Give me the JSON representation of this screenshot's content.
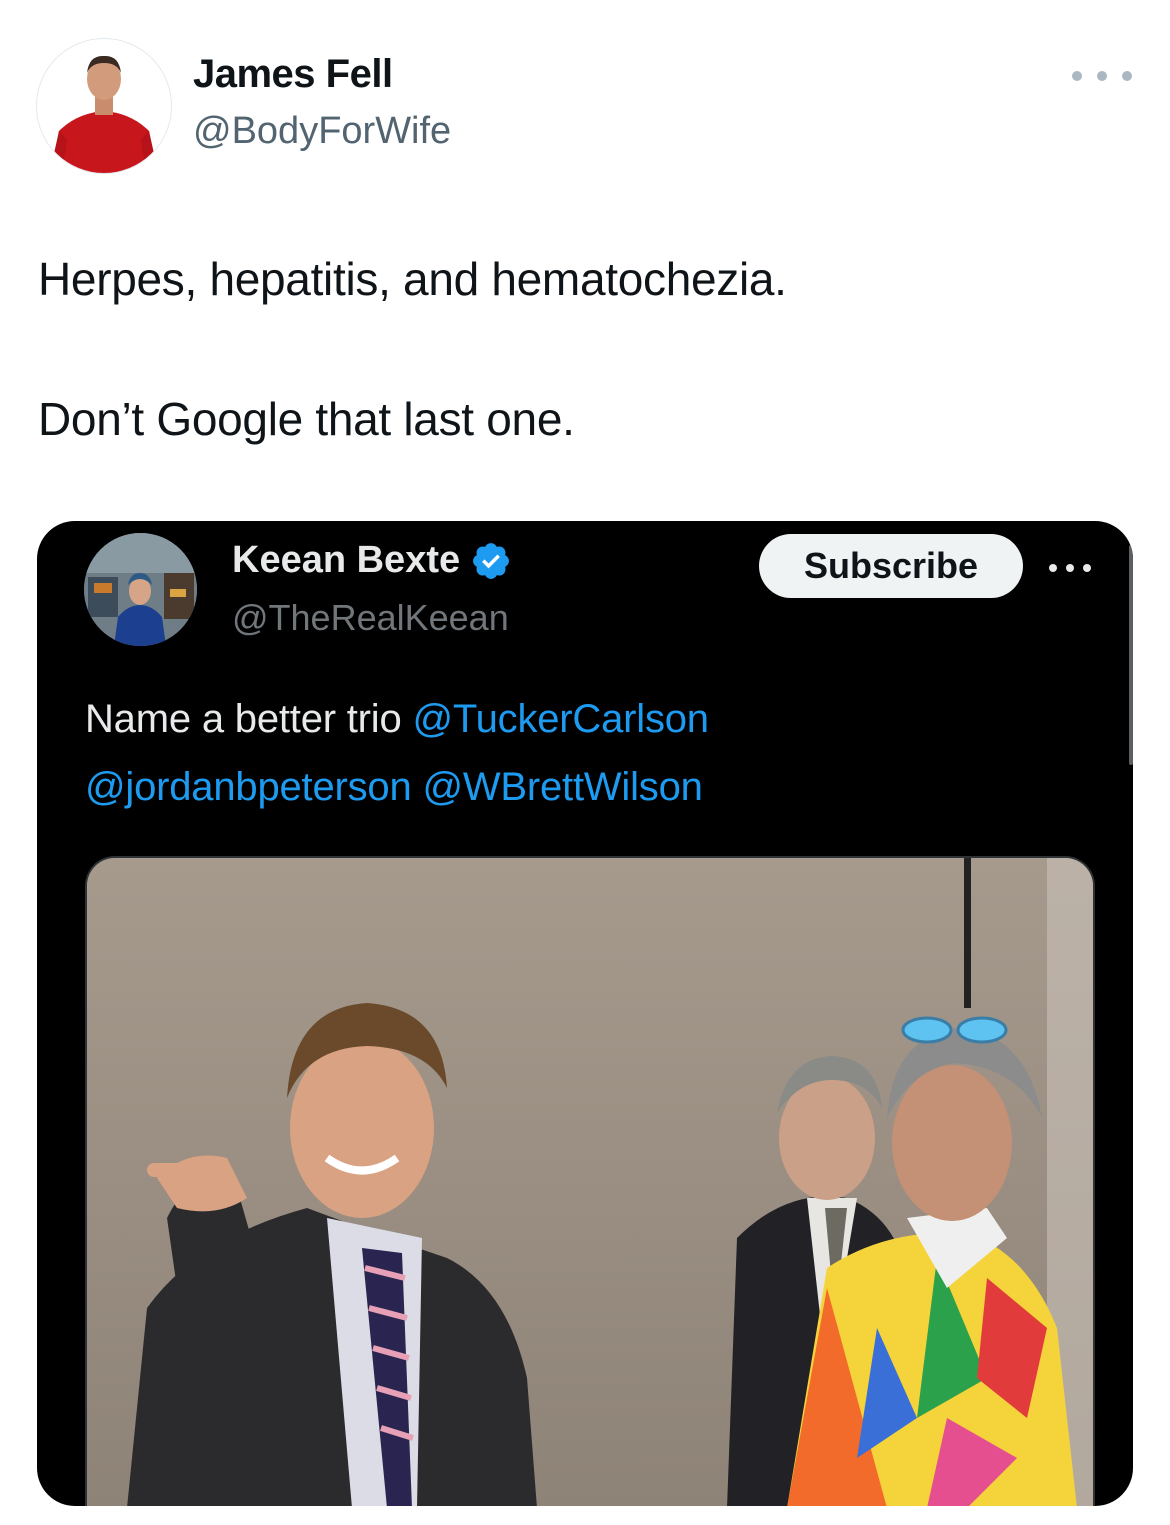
{
  "tweet": {
    "author": {
      "name": "James Fell",
      "handle": "@BodyForWife"
    },
    "text_line1": "Herpes, hepatitis, and hematochezia.",
    "text_line2": "Don’t Google that last one."
  },
  "embedded_tweet": {
    "author": {
      "name": "Keean Bexte",
      "handle": "@TheRealKeean"
    },
    "subscribe_label": "Subscribe",
    "text_prefix": "Name a better trio ",
    "mentions": [
      "@TuckerCarlson",
      "@jordanbpeterson",
      "@WBrettWilson"
    ]
  },
  "colors": {
    "link": "#1d9bf0",
    "verified": "#1d9bf0",
    "embed_background": "#000000"
  },
  "icons": {
    "more": "more-horizontal-icon",
    "verified": "verified-badge-icon"
  }
}
